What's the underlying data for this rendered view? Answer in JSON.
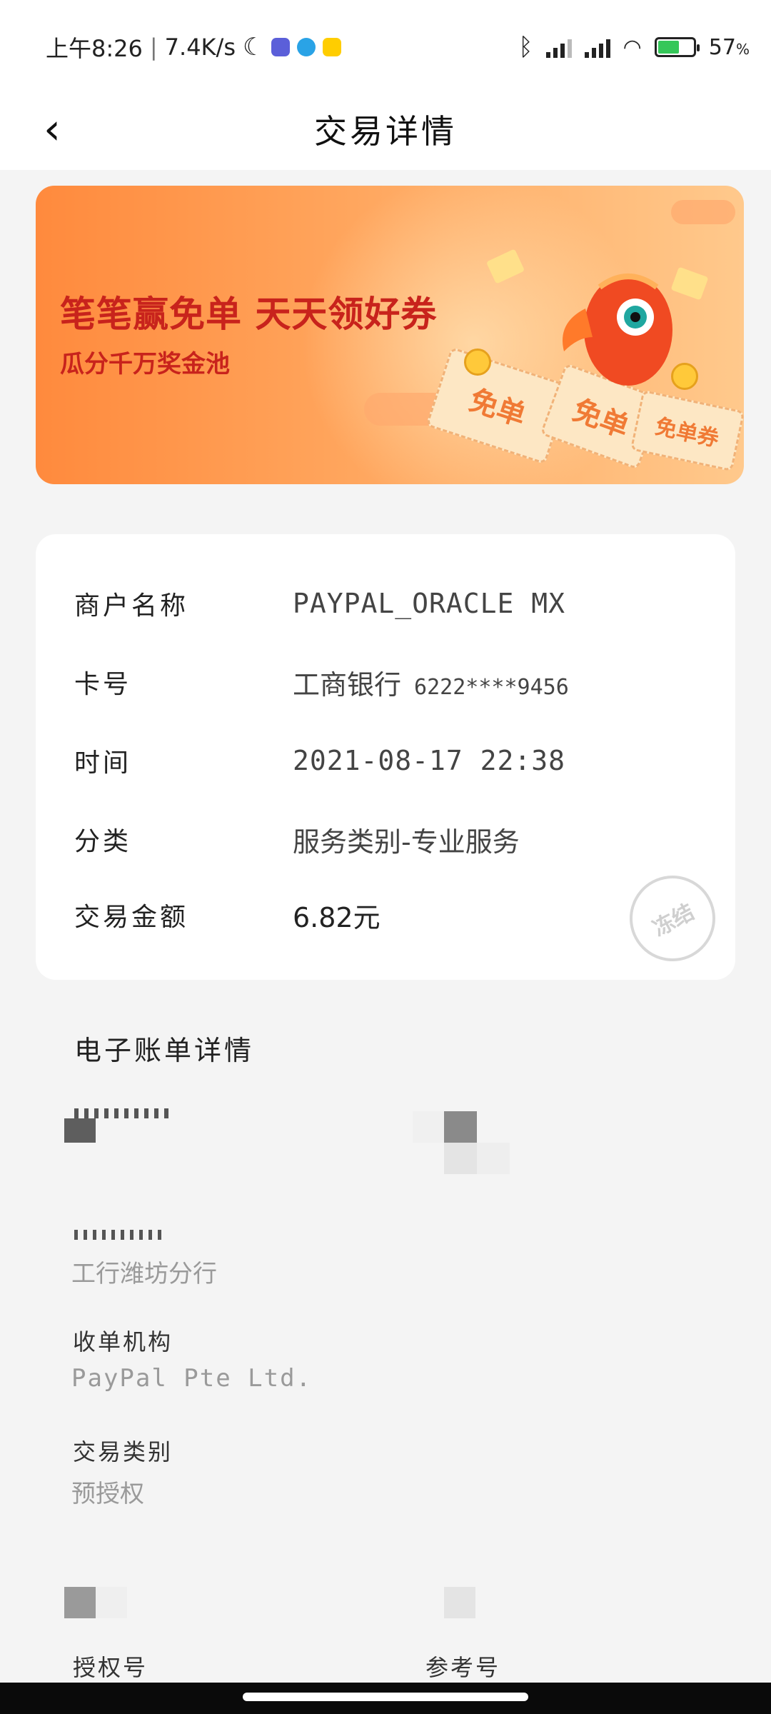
{
  "status_bar": {
    "time": "上午8:26",
    "net_speed": "7.4K/s",
    "battery": "57",
    "battery_unit": "%",
    "battery_level": 0.57,
    "icons": [
      "moon-icon",
      "app-icon",
      "telegram-icon",
      "meituan-icon",
      "bluetooth-icon",
      "signal-icon",
      "roaming-signal-icon",
      "wifi-icon",
      "battery-icon"
    ]
  },
  "header": {
    "back_icon": "chevron-left-icon",
    "title": "交易详情"
  },
  "banner": {
    "headline": "笔笔赢免单 天天领好券",
    "subline": "瓜分千万奖金池",
    "ticket_1": "免单",
    "ticket_2": "免单",
    "ticket_3": "免单券"
  },
  "info": {
    "merchant_label": "商户名称",
    "merchant_value": "PAYPAL_ORACLE MX",
    "card_label": "卡号",
    "card_bank": "工商银行",
    "card_number": "6222****9456",
    "time_label": "时间",
    "time_value": "2021-08-17 22:38",
    "category_label": "分类",
    "category_value": "服务类别-专业服务",
    "amount_label": "交易金额",
    "amount_value": "6.82元",
    "stamp": "冻结"
  },
  "ebill": {
    "title": "电子账单详情",
    "issuer_value": "工行潍坊分行",
    "acquirer_label": "收单机构",
    "acquirer_value": "PayPal Pte Ltd.",
    "type_label": "交易类别",
    "type_value": "预授权",
    "auth_label": "授权号",
    "ref_label": "参考号"
  },
  "colors": {
    "banner_text": "#c8231c",
    "accent": "#ff8a3d"
  }
}
